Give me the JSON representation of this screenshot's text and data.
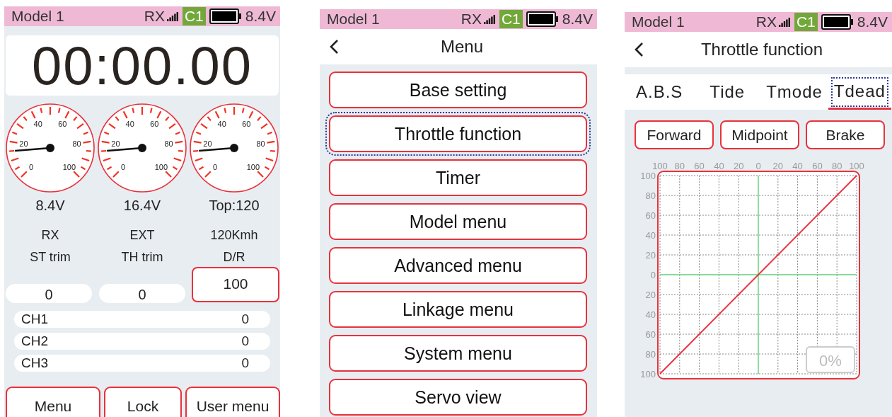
{
  "screens": [
    {
      "kind": "home",
      "status_bar": {
        "model": "Model 1",
        "rx_label": "RX",
        "channel_badge": "C1",
        "voltage": "8.4V"
      },
      "timer": "00:00.00",
      "gauges": [
        {
          "level": 0.15,
          "scale_labels": [
            "0",
            "20",
            "40",
            "60",
            "80",
            "100"
          ],
          "reading": "8.4V",
          "caption": "RX"
        },
        {
          "level": 0.15,
          "scale_labels": [
            "0",
            "20",
            "40",
            "60",
            "80",
            "100"
          ],
          "reading": "16.4V",
          "caption": "EXT"
        },
        {
          "level": 0.15,
          "scale_labels": [
            "0",
            "20",
            "40",
            "60",
            "80",
            "100"
          ],
          "reading": "Top:120",
          "caption": "120Kmh"
        }
      ],
      "trims": [
        {
          "kind": "pill",
          "label": "ST trim",
          "value": "0"
        },
        {
          "kind": "pill",
          "label": "TH trim",
          "value": "0"
        },
        {
          "kind": "boxed",
          "label": "D/R",
          "value": "100"
        }
      ],
      "channels": [
        {
          "name": "CH1",
          "value": "0"
        },
        {
          "name": "CH2",
          "value": "0"
        },
        {
          "name": "CH3",
          "value": "0"
        }
      ],
      "buttons": [
        "Menu",
        "Lock",
        "User menu"
      ]
    },
    {
      "kind": "menu",
      "status_bar": {
        "model": "Model 1",
        "rx_label": "RX",
        "channel_badge": "C1",
        "voltage": "8.4V"
      },
      "header": {
        "title": "Menu"
      },
      "items": [
        {
          "label": "Base setting",
          "selected": false
        },
        {
          "label": "Throttle function",
          "selected": true
        },
        {
          "label": "Timer",
          "selected": false
        },
        {
          "label": "Model menu",
          "selected": false
        },
        {
          "label": "Advanced menu",
          "selected": false
        },
        {
          "label": "Linkage menu",
          "selected": false
        },
        {
          "label": "System menu",
          "selected": false
        },
        {
          "label": "Servo view",
          "selected": false
        }
      ]
    },
    {
      "kind": "throttle",
      "status_bar": {
        "model": "Model 1",
        "rx_label": "RX",
        "channel_badge": "C1",
        "voltage": "8.4V"
      },
      "header": {
        "title": "Throttle function"
      },
      "tabs": [
        {
          "label": "A.B.S",
          "selected": false
        },
        {
          "label": "Tide",
          "selected": false
        },
        {
          "label": "Tmode",
          "selected": false
        },
        {
          "label": "Tdead",
          "selected": true
        }
      ],
      "buttons": [
        "Forward",
        "Midpoint",
        "Brake"
      ],
      "chart": {
        "readout": "0%",
        "chart_data": {
          "type": "line",
          "x": [
            -100,
            100
          ],
          "series": [
            {
              "color": "#e8323c",
              "values": [
                -100,
                100
              ]
            }
          ],
          "grid": true,
          "xlim": [
            -100,
            100
          ],
          "ylim": [
            -100,
            100
          ],
          "xticks": [
            {
              "value": -100,
              "label": "100"
            },
            {
              "value": -80,
              "label": "80"
            },
            {
              "value": -60,
              "label": "60"
            },
            {
              "value": -40,
              "label": "40"
            },
            {
              "value": -20,
              "label": "20"
            },
            0,
            20,
            40,
            60,
            80,
            100
          ],
          "yticks": [
            {
              "value": -100,
              "label": "100"
            },
            {
              "value": -80,
              "label": "80"
            },
            {
              "value": -60,
              "label": "60"
            },
            {
              "value": -40,
              "label": "40"
            },
            {
              "value": -20,
              "label": "20"
            },
            0,
            20,
            40,
            60,
            80,
            100
          ]
        }
      }
    }
  ]
}
